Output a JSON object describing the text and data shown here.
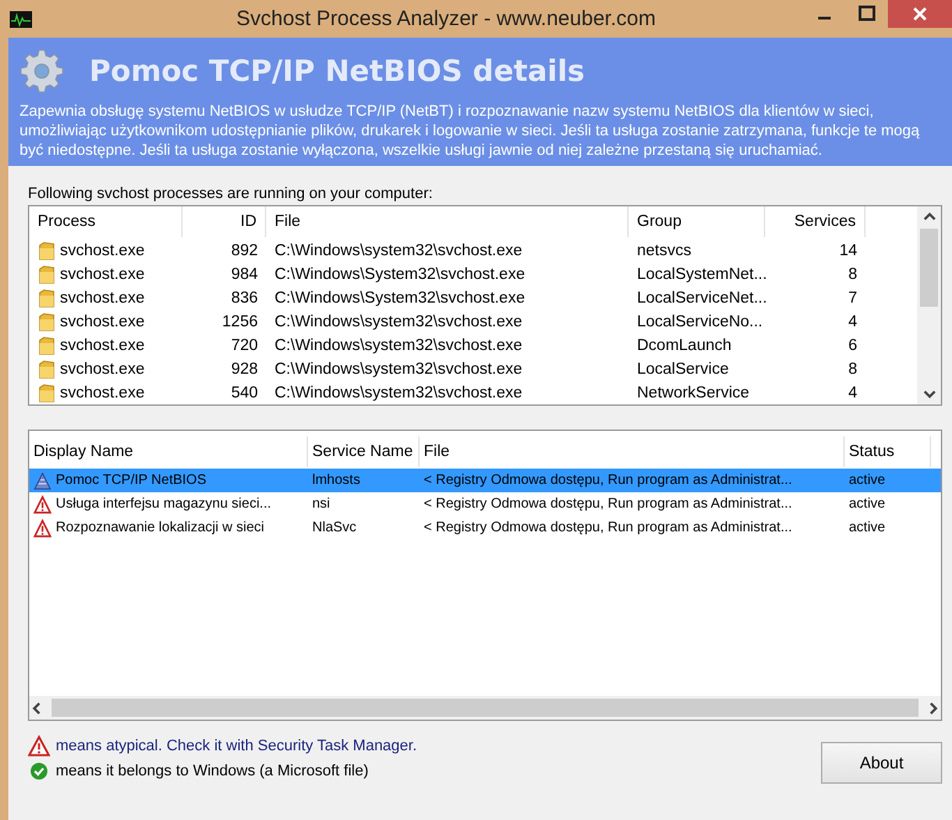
{
  "window": {
    "title": "Svchost Process Analyzer - www.neuber.com"
  },
  "header": {
    "title": "Pomoc TCP/IP NetBIOS details",
    "description": "Zapewnia obsługę systemu NetBIOS w usłudze TCP/IP (NetBT) i rozpoznawanie nazw systemu NetBIOS dla klientów w sieci, umożliwiając użytkownikom udostępnianie plików, drukarek i logowanie w sieci. Jeśli ta usługa zostanie zatrzymana, funkcje te mogą być niedostępne. Jeśli ta usługa zostanie wyłączona, wszelkie usługi jawnie od niej zależne przestaną się uruchamiać."
  },
  "processes": {
    "label": "Following svchost processes are running on your computer:",
    "columns": [
      "Process",
      "ID",
      "File",
      "Group",
      "Services"
    ],
    "rows": [
      {
        "process": "svchost.exe",
        "id": "892",
        "file": "C:\\Windows\\system32\\svchost.exe",
        "group": "netsvcs",
        "services": "14"
      },
      {
        "process": "svchost.exe",
        "id": "984",
        "file": "C:\\Windows\\System32\\svchost.exe",
        "group": "LocalSystemNet...",
        "services": "8"
      },
      {
        "process": "svchost.exe",
        "id": "836",
        "file": "C:\\Windows\\System32\\svchost.exe",
        "group": "LocalServiceNet...",
        "services": "7"
      },
      {
        "process": "svchost.exe",
        "id": "1256",
        "file": "C:\\Windows\\system32\\svchost.exe",
        "group": "LocalServiceNo...",
        "services": "4"
      },
      {
        "process": "svchost.exe",
        "id": "720",
        "file": "C:\\Windows\\system32\\svchost.exe",
        "group": "DcomLaunch",
        "services": "6"
      },
      {
        "process": "svchost.exe",
        "id": "928",
        "file": "C:\\Windows\\system32\\svchost.exe",
        "group": "LocalService",
        "services": "8"
      },
      {
        "process": "svchost.exe",
        "id": "540",
        "file": "C:\\Windows\\system32\\svchost.exe",
        "group": "NetworkService",
        "services": "4"
      }
    ]
  },
  "services": {
    "columns": [
      "Display Name",
      "Service Name",
      "File",
      "Status"
    ],
    "rows": [
      {
        "kind": "system",
        "selected": true,
        "display_name": "Pomoc TCP/IP NetBIOS",
        "service_name": "lmhosts",
        "file": "< Registry Odmowa dostępu, Run program as Administrat...",
        "status": "active"
      },
      {
        "kind": "warning",
        "selected": false,
        "display_name": "Usługa interfejsu magazynu sieci...",
        "service_name": "nsi",
        "file": "< Registry Odmowa dostępu, Run program as Administrat...",
        "status": "active"
      },
      {
        "kind": "warning",
        "selected": false,
        "display_name": "Rozpoznawanie lokalizacji w sieci",
        "service_name": "NlaSvc",
        "file": "< Registry Odmowa dostępu, Run program as Administrat...",
        "status": "active"
      }
    ]
  },
  "legend": [
    {
      "kind": "warning",
      "text": "means atypical. Check it with Security Task Manager."
    },
    {
      "kind": "ok",
      "text": "means it belongs to Windows (a Microsoft file)"
    }
  ],
  "buttons": [
    "About"
  ]
}
